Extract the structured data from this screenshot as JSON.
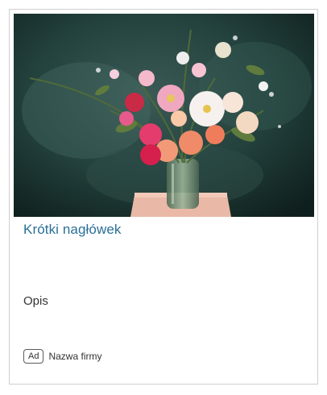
{
  "ad": {
    "image_alt": "Bukiet kwiatów w szklanym wazonie",
    "headline": "Krótki nagłówek",
    "description": "Opis",
    "badge": "Ad",
    "advertiser": "Nazwa firmy"
  }
}
